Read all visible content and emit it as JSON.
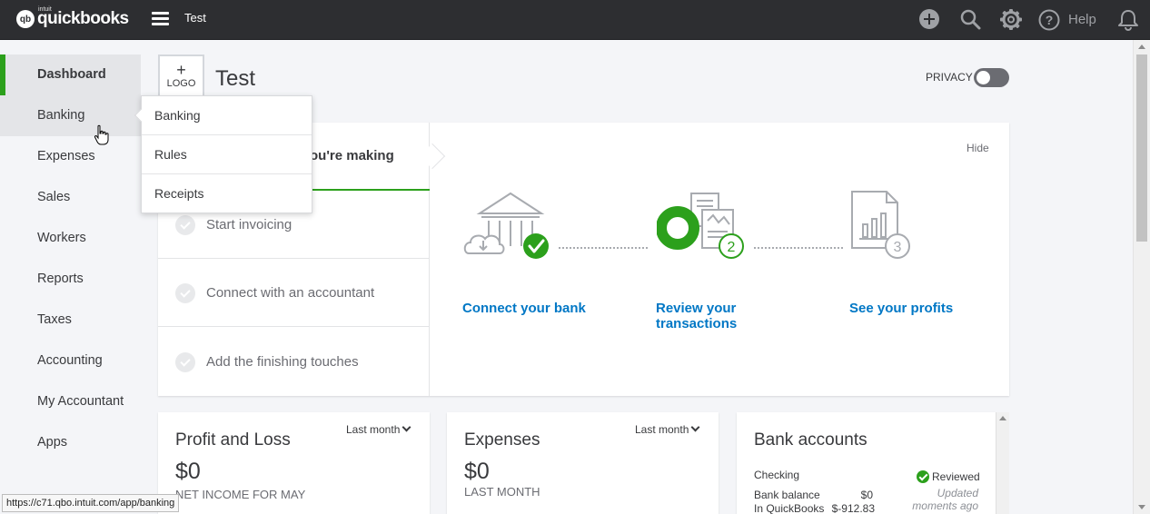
{
  "header": {
    "logo_small": "intuit",
    "logo_text": "quickbooks",
    "company_name": "Test",
    "help_label": "Help",
    "icons": [
      "hamburger-icon",
      "plus-icon",
      "search-icon",
      "gear-icon",
      "help-icon",
      "bell-icon"
    ]
  },
  "sidebar": {
    "items": [
      {
        "label": "Dashboard",
        "state": "active"
      },
      {
        "label": "Banking",
        "state": "hover"
      },
      {
        "label": "Expenses"
      },
      {
        "label": "Sales"
      },
      {
        "label": "Workers"
      },
      {
        "label": "Reports"
      },
      {
        "label": "Taxes"
      },
      {
        "label": "Accounting"
      },
      {
        "label": "My Accountant"
      },
      {
        "label": "Apps"
      }
    ]
  },
  "flyout": {
    "items": [
      "Banking",
      "Rules",
      "Receipts"
    ]
  },
  "page": {
    "logo_plus": "+",
    "logo_label": "LOGO",
    "title": "Test",
    "privacy_label": "PRIVACY",
    "privacy_on": false
  },
  "setup": {
    "top_text": "ou're making",
    "steps": [
      "Start invoicing",
      "Connect with an accountant",
      "Add the finishing touches"
    ],
    "hide_label": "Hide",
    "links": [
      "Connect your bank",
      "Review your transactions",
      "See your profits"
    ],
    "badges": [
      "2",
      "3"
    ]
  },
  "cards": {
    "profit_loss": {
      "title": "Profit and Loss",
      "period": "Last month",
      "amount": "$0",
      "sub": "NET INCOME FOR MAY"
    },
    "expenses": {
      "title": "Expenses",
      "period": "Last month",
      "amount": "$0",
      "sub": "LAST MONTH"
    },
    "bank": {
      "title": "Bank accounts",
      "account": "Checking",
      "status": "Reviewed",
      "rows": [
        {
          "label": "Bank balance",
          "value": "$0"
        },
        {
          "label": "In QuickBooks",
          "value": "$-912.83"
        }
      ],
      "updated": "Updated moments ago"
    }
  },
  "status_bar": {
    "url": "https://c71.qbo.intuit.com/app/banking"
  },
  "colors": {
    "topbar": "#2d2e31",
    "accent_green": "#2ca01c",
    "link_blue": "#0077c5"
  }
}
